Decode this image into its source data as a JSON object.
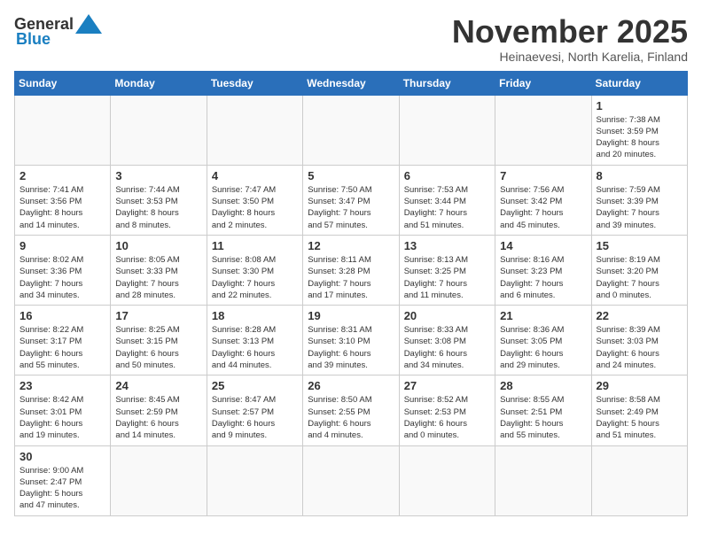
{
  "logo": {
    "general": "General",
    "blue": "Blue"
  },
  "title": "November 2025",
  "subtitle": "Heinaevesi, North Karelia, Finland",
  "headers": [
    "Sunday",
    "Monday",
    "Tuesday",
    "Wednesday",
    "Thursday",
    "Friday",
    "Saturday"
  ],
  "weeks": [
    [
      {
        "day": "",
        "info": ""
      },
      {
        "day": "",
        "info": ""
      },
      {
        "day": "",
        "info": ""
      },
      {
        "day": "",
        "info": ""
      },
      {
        "day": "",
        "info": ""
      },
      {
        "day": "",
        "info": ""
      },
      {
        "day": "1",
        "info": "Sunrise: 7:38 AM\nSunset: 3:59 PM\nDaylight: 8 hours\nand 20 minutes."
      }
    ],
    [
      {
        "day": "2",
        "info": "Sunrise: 7:41 AM\nSunset: 3:56 PM\nDaylight: 8 hours\nand 14 minutes."
      },
      {
        "day": "3",
        "info": "Sunrise: 7:44 AM\nSunset: 3:53 PM\nDaylight: 8 hours\nand 8 minutes."
      },
      {
        "day": "4",
        "info": "Sunrise: 7:47 AM\nSunset: 3:50 PM\nDaylight: 8 hours\nand 2 minutes."
      },
      {
        "day": "5",
        "info": "Sunrise: 7:50 AM\nSunset: 3:47 PM\nDaylight: 7 hours\nand 57 minutes."
      },
      {
        "day": "6",
        "info": "Sunrise: 7:53 AM\nSunset: 3:44 PM\nDaylight: 7 hours\nand 51 minutes."
      },
      {
        "day": "7",
        "info": "Sunrise: 7:56 AM\nSunset: 3:42 PM\nDaylight: 7 hours\nand 45 minutes."
      },
      {
        "day": "8",
        "info": "Sunrise: 7:59 AM\nSunset: 3:39 PM\nDaylight: 7 hours\nand 39 minutes."
      }
    ],
    [
      {
        "day": "9",
        "info": "Sunrise: 8:02 AM\nSunset: 3:36 PM\nDaylight: 7 hours\nand 34 minutes."
      },
      {
        "day": "10",
        "info": "Sunrise: 8:05 AM\nSunset: 3:33 PM\nDaylight: 7 hours\nand 28 minutes."
      },
      {
        "day": "11",
        "info": "Sunrise: 8:08 AM\nSunset: 3:30 PM\nDaylight: 7 hours\nand 22 minutes."
      },
      {
        "day": "12",
        "info": "Sunrise: 8:11 AM\nSunset: 3:28 PM\nDaylight: 7 hours\nand 17 minutes."
      },
      {
        "day": "13",
        "info": "Sunrise: 8:13 AM\nSunset: 3:25 PM\nDaylight: 7 hours\nand 11 minutes."
      },
      {
        "day": "14",
        "info": "Sunrise: 8:16 AM\nSunset: 3:23 PM\nDaylight: 7 hours\nand 6 minutes."
      },
      {
        "day": "15",
        "info": "Sunrise: 8:19 AM\nSunset: 3:20 PM\nDaylight: 7 hours\nand 0 minutes."
      }
    ],
    [
      {
        "day": "16",
        "info": "Sunrise: 8:22 AM\nSunset: 3:17 PM\nDaylight: 6 hours\nand 55 minutes."
      },
      {
        "day": "17",
        "info": "Sunrise: 8:25 AM\nSunset: 3:15 PM\nDaylight: 6 hours\nand 50 minutes."
      },
      {
        "day": "18",
        "info": "Sunrise: 8:28 AM\nSunset: 3:13 PM\nDaylight: 6 hours\nand 44 minutes."
      },
      {
        "day": "19",
        "info": "Sunrise: 8:31 AM\nSunset: 3:10 PM\nDaylight: 6 hours\nand 39 minutes."
      },
      {
        "day": "20",
        "info": "Sunrise: 8:33 AM\nSunset: 3:08 PM\nDaylight: 6 hours\nand 34 minutes."
      },
      {
        "day": "21",
        "info": "Sunrise: 8:36 AM\nSunset: 3:05 PM\nDaylight: 6 hours\nand 29 minutes."
      },
      {
        "day": "22",
        "info": "Sunrise: 8:39 AM\nSunset: 3:03 PM\nDaylight: 6 hours\nand 24 minutes."
      }
    ],
    [
      {
        "day": "23",
        "info": "Sunrise: 8:42 AM\nSunset: 3:01 PM\nDaylight: 6 hours\nand 19 minutes."
      },
      {
        "day": "24",
        "info": "Sunrise: 8:45 AM\nSunset: 2:59 PM\nDaylight: 6 hours\nand 14 minutes."
      },
      {
        "day": "25",
        "info": "Sunrise: 8:47 AM\nSunset: 2:57 PM\nDaylight: 6 hours\nand 9 minutes."
      },
      {
        "day": "26",
        "info": "Sunrise: 8:50 AM\nSunset: 2:55 PM\nDaylight: 6 hours\nand 4 minutes."
      },
      {
        "day": "27",
        "info": "Sunrise: 8:52 AM\nSunset: 2:53 PM\nDaylight: 6 hours\nand 0 minutes."
      },
      {
        "day": "28",
        "info": "Sunrise: 8:55 AM\nSunset: 2:51 PM\nDaylight: 5 hours\nand 55 minutes."
      },
      {
        "day": "29",
        "info": "Sunrise: 8:58 AM\nSunset: 2:49 PM\nDaylight: 5 hours\nand 51 minutes."
      }
    ],
    [
      {
        "day": "30",
        "info": "Sunrise: 9:00 AM\nSunset: 2:47 PM\nDaylight: 5 hours\nand 47 minutes."
      },
      {
        "day": "",
        "info": ""
      },
      {
        "day": "",
        "info": ""
      },
      {
        "day": "",
        "info": ""
      },
      {
        "day": "",
        "info": ""
      },
      {
        "day": "",
        "info": ""
      },
      {
        "day": "",
        "info": ""
      }
    ]
  ]
}
